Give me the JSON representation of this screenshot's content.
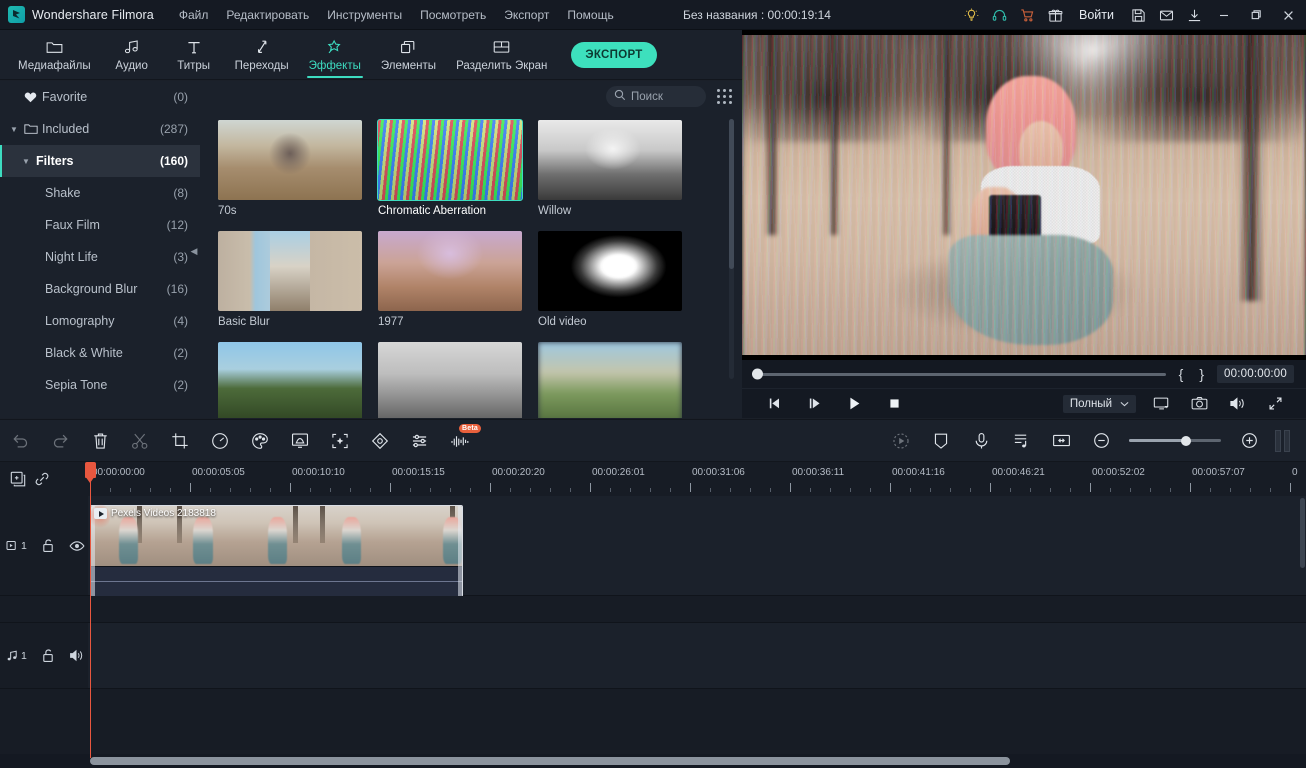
{
  "app": {
    "brand": "Wondershare Filmora",
    "project_title": "Без названия : 00:00:19:14"
  },
  "menubar": {
    "items": [
      {
        "label": "Файл"
      },
      {
        "label": "Редактировать"
      },
      {
        "label": "Инструменты"
      },
      {
        "label": "Посмотреть"
      },
      {
        "label": "Экспорт"
      },
      {
        "label": "Помощь"
      }
    ]
  },
  "titlebar_right": {
    "icons": [
      {
        "name": "lightbulb-icon",
        "title": "Подсказки"
      },
      {
        "name": "headset-icon",
        "title": "Поддержка"
      },
      {
        "name": "cart-icon",
        "title": "Магазин"
      },
      {
        "name": "gift-icon",
        "title": "Подарок"
      }
    ],
    "signin_label": "Войти",
    "icons2": [
      {
        "name": "save-icon",
        "title": "Сохранить"
      },
      {
        "name": "mail-icon",
        "title": "Почта"
      },
      {
        "name": "download-icon",
        "title": "Загрузки"
      }
    ],
    "window_controls": [
      {
        "name": "minimize-button"
      },
      {
        "name": "maximize-button"
      },
      {
        "name": "close-button"
      }
    ]
  },
  "toptabs": {
    "items": [
      {
        "label": "Медиафайлы",
        "icon": "folder-icon",
        "active": false
      },
      {
        "label": "Аудио",
        "icon": "music-note-icon",
        "active": false
      },
      {
        "label": "Титры",
        "icon": "text-icon",
        "active": false
      },
      {
        "label": "Переходы",
        "icon": "transition-icon",
        "active": false
      },
      {
        "label": "Эффекты",
        "icon": "sparkle-icon",
        "active": true
      },
      {
        "label": "Элементы",
        "icon": "layers-icon",
        "active": false
      },
      {
        "label": "Разделить Экран",
        "icon": "split-screen-icon",
        "active": false
      }
    ],
    "export_label": "ЭКСПОРТ"
  },
  "categories": {
    "items": [
      {
        "label": "Favorite",
        "count": "(0)",
        "icon": "heart-icon",
        "indent": 0,
        "caret": "",
        "selected": false
      },
      {
        "label": "Included",
        "count": "(287)",
        "icon": "folder-icon",
        "indent": 0,
        "caret": "▼",
        "selected": false
      },
      {
        "label": "Filters",
        "count": "(160)",
        "icon": "",
        "indent": 1,
        "caret": "▼",
        "selected": true
      },
      {
        "label": "Shake",
        "count": "(8)",
        "icon": "",
        "indent": 2,
        "caret": "",
        "selected": false
      },
      {
        "label": "Faux Film",
        "count": "(12)",
        "icon": "",
        "indent": 2,
        "caret": "",
        "selected": false
      },
      {
        "label": "Night Life",
        "count": "(3)",
        "icon": "",
        "indent": 2,
        "caret": "",
        "selected": false
      },
      {
        "label": "Background Blur",
        "count": "(16)",
        "icon": "",
        "indent": 2,
        "caret": "",
        "selected": false
      },
      {
        "label": "Lomography",
        "count": "(4)",
        "icon": "",
        "indent": 2,
        "caret": "",
        "selected": false
      },
      {
        "label": "Black & White",
        "count": "(2)",
        "icon": "",
        "indent": 2,
        "caret": "",
        "selected": false
      },
      {
        "label": "Sepia Tone",
        "count": "(2)",
        "icon": "",
        "indent": 2,
        "caret": "",
        "selected": false
      }
    ]
  },
  "effects_panel": {
    "search_placeholder": "Поиск",
    "search_value": "",
    "grid_toggle_name": "grid-view-toggle",
    "items": [
      {
        "label": "70s",
        "art": "v70s",
        "selected": false
      },
      {
        "label": "Chromatic Aberration",
        "art": "vchrom",
        "selected": true
      },
      {
        "label": "Willow",
        "art": "vwillow",
        "selected": false
      },
      {
        "label": "Basic Blur",
        "art": "vblur",
        "selected": false
      },
      {
        "label": "1977",
        "art": "v1977",
        "selected": false
      },
      {
        "label": "Old video",
        "art": "voldvid",
        "selected": false
      },
      {
        "label": "",
        "art": "vrow3a",
        "selected": false
      },
      {
        "label": "",
        "art": "vrow3b",
        "selected": false
      },
      {
        "label": "",
        "art": "vrow3c",
        "selected": false
      }
    ]
  },
  "preview": {
    "timecode": "00:00:00:00",
    "mark_in_label": "{",
    "mark_out_label": "}",
    "quality_label": "Полный",
    "controls": [
      {
        "name": "prev-frame-button"
      },
      {
        "name": "next-frame-button"
      },
      {
        "name": "play-button"
      },
      {
        "name": "stop-button"
      }
    ],
    "right_controls": [
      {
        "name": "display-settings-button"
      },
      {
        "name": "snapshot-button"
      },
      {
        "name": "volume-button"
      },
      {
        "name": "fullscreen-button"
      }
    ]
  },
  "timeline_toolbar": {
    "left_buttons": [
      {
        "name": "undo-button",
        "icon": "undo-icon",
        "dim": true
      },
      {
        "name": "redo-button",
        "icon": "redo-icon",
        "dim": true
      },
      {
        "name": "delete-button",
        "icon": "trash-icon",
        "dim": false
      },
      {
        "name": "split-button",
        "icon": "scissors-icon",
        "dim": true
      },
      {
        "name": "crop-button",
        "icon": "crop-icon",
        "dim": false
      },
      {
        "name": "speed-button",
        "icon": "speed-icon",
        "dim": false
      },
      {
        "name": "color-button",
        "icon": "palette-icon",
        "dim": false
      },
      {
        "name": "green-screen-button",
        "icon": "chroma-key-icon",
        "dim": false
      },
      {
        "name": "auto-enhance-button",
        "icon": "enhance-icon",
        "dim": false
      },
      {
        "name": "keyframe-button",
        "icon": "keyframe-icon",
        "dim": false
      },
      {
        "name": "adjust-button",
        "icon": "sliders-icon",
        "dim": false
      },
      {
        "name": "audio-beta-button",
        "icon": "waveform-icon",
        "dim": false,
        "badge": "Beta"
      }
    ],
    "right_buttons": [
      {
        "name": "render-preview-button",
        "icon": "render-icon",
        "dim": true
      },
      {
        "name": "marker-button",
        "icon": "marker-icon",
        "dim": false
      },
      {
        "name": "voiceover-button",
        "icon": "microphone-icon",
        "dim": false
      },
      {
        "name": "audio-mixer-button",
        "icon": "audio-mixer-icon",
        "dim": false
      },
      {
        "name": "fit-timeline-button",
        "icon": "fit-width-icon",
        "dim": false
      }
    ],
    "zoom_out_name": "zoom-out-button",
    "zoom_in_name": "zoom-in-button",
    "zoom_value_percent": 62
  },
  "timeline": {
    "tools": [
      {
        "name": "add-marker-button",
        "icon": "add-media-icon"
      },
      {
        "name": "link-clips-button",
        "icon": "link-icon"
      }
    ],
    "ruler_labels": [
      "00:00:00:00",
      "00:00:05:05",
      "00:00:10:10",
      "00:00:15:15",
      "00:00:20:20",
      "00:00:26:01",
      "00:00:31:06",
      "00:00:36:11",
      "00:00:41:16",
      "00:00:46:21",
      "00:00:52:02",
      "00:00:57:07"
    ],
    "ruler_last_partial": "0",
    "video_track": {
      "name": "1",
      "lock_icon": "unlock-icon",
      "visibility_icon": "eye-icon",
      "clip": {
        "label": "Pexels Videos 2183818"
      }
    },
    "audio_track": {
      "name": "1",
      "lock_icon": "unlock-icon",
      "mute_icon": "speaker-icon"
    }
  },
  "colors": {
    "accent": "#3ddcc0",
    "playhead": "#e8573f",
    "panel_bg": "#1b212b",
    "window_bg": "#171c25",
    "titlebar_bg": "#151a23",
    "beta_badge": "#e8603c"
  }
}
